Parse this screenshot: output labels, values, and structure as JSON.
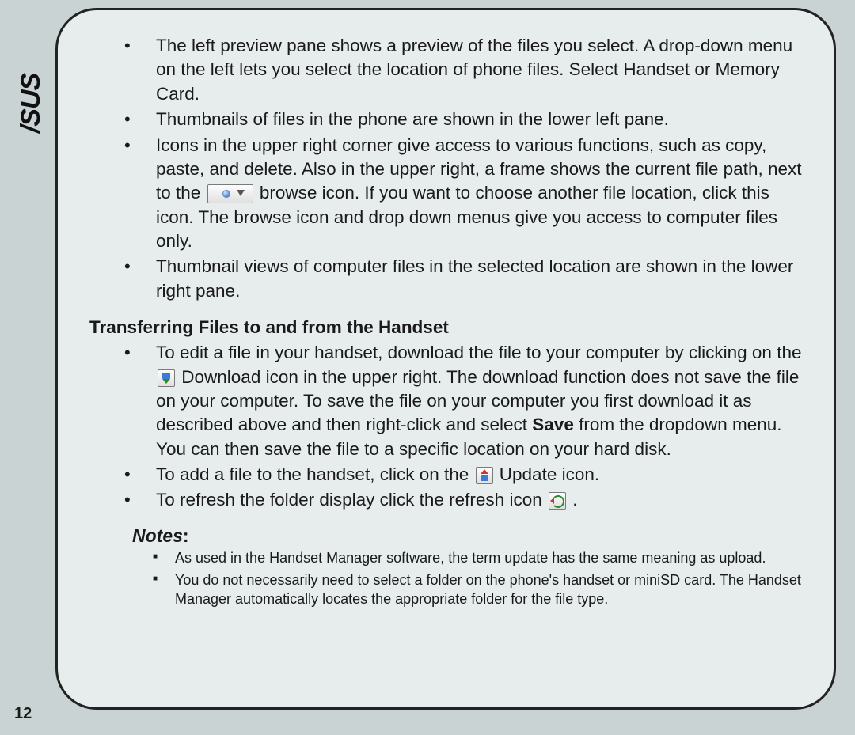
{
  "brand": "/SUS",
  "page_number": "12",
  "intro_items": [
    "The left preview pane shows a preview of the files you select. A drop-down menu on the left lets you select the location of phone files. Select Handset or Memory Card.",
    "Thumbnails of files in the phone are shown in the lower left pane.",
    {
      "pre": "Icons in the upper right corner give access to various functions, such as copy, paste, and delete. Also in the upper right, a frame shows the current file path, next to the ",
      "post": " browse icon. If you want to choose another file location, click this icon. The browse icon and drop down menus give you access to computer files only."
    },
    "Thumbnail views of computer files in the selected location are shown in the lower right pane."
  ],
  "section_heading": "Transferring Files to and from the Handset",
  "transfer_items": {
    "item1": {
      "pre": "To edit a file in your handset, download the file to your computer by clicking on the ",
      "mid": " Download icon in the upper right. The download function does not save the file on your computer. To save the file on your computer you first download it as described above and then right-click and select ",
      "bold": "Save",
      "post": " from the dropdown menu. You can then save the file to a specific location on your hard disk."
    },
    "item2": {
      "pre": "To add a file to the handset,  click on the ",
      "post": " Update icon."
    },
    "item3": {
      "pre": "To refresh the folder display click the refresh icon ",
      "post": " ."
    }
  },
  "notes_heading": "Notes",
  "notes_colon": ":",
  "notes": [
    "As used in the Handset Manager software, the term update has the same meaning as upload.",
    "You do not necessarily need to select a folder on the phone's handset or miniSD card. The Handset Manager automatically locates the appropriate folder for the file type."
  ]
}
